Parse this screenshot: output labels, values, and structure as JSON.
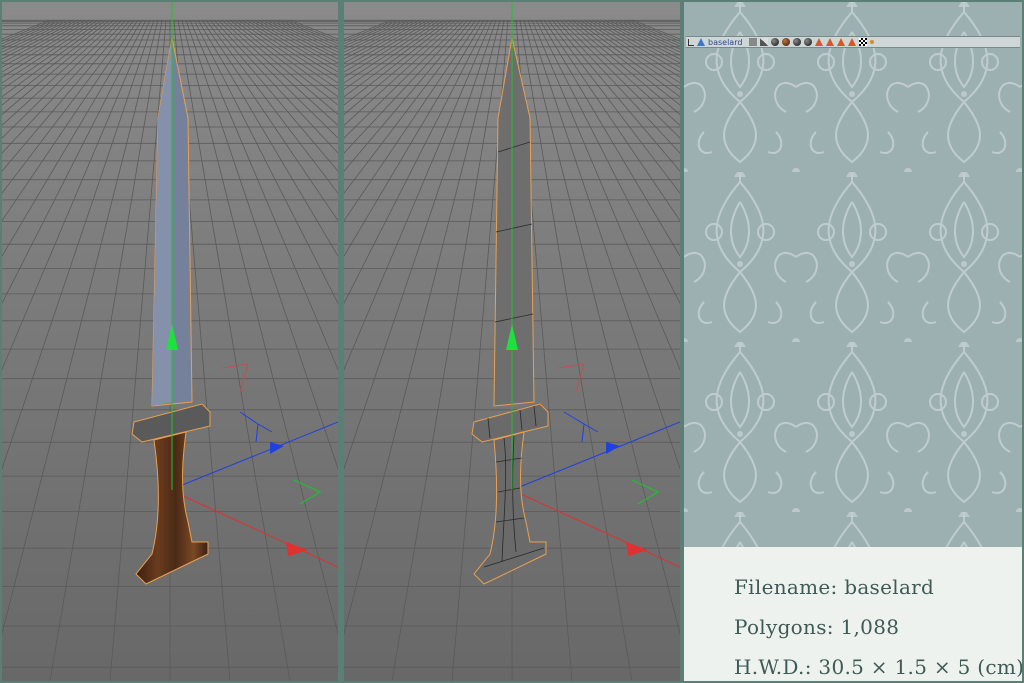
{
  "viewports": [
    {
      "id": "textured",
      "mode": "textured-shaded"
    },
    {
      "id": "wireframe",
      "mode": "shaded-with-wireframe"
    }
  ],
  "toolbar": {
    "object_name": "baselard"
  },
  "info": {
    "filename_label": "Filename:",
    "filename_value": "baselard",
    "polygons_label": "Polygons:",
    "polygons_value": "1,088",
    "dims_label": "H.W.D.:",
    "dims_value": "30.5 × 1.5 × 5 (cm)"
  },
  "colors": {
    "viewport_bg": "#6e6e6e",
    "grid_line": "#5a5a5a",
    "panel_bg": "#9cb0b2",
    "info_bg": "#eef2ef",
    "info_text": "#3f5a55",
    "axis_x": "#e03030",
    "axis_y": "#20c030",
    "axis_z": "#2040e0",
    "selection_outline": "#e8a050",
    "blade": "#6c7384"
  }
}
